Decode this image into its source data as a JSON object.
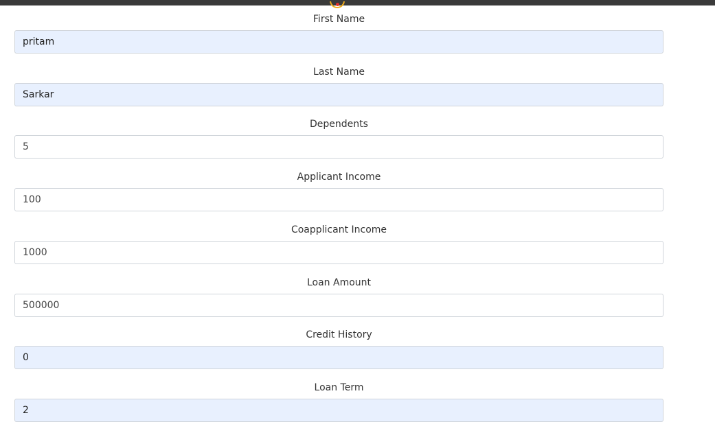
{
  "form": {
    "fields": [
      {
        "label": "First Name",
        "value": "pritam",
        "autofill": true
      },
      {
        "label": "Last Name",
        "value": "Sarkar",
        "autofill": true
      },
      {
        "label": "Dependents",
        "value": "5",
        "autofill": false
      },
      {
        "label": "Applicant Income",
        "value": "100",
        "autofill": false
      },
      {
        "label": "Coapplicant Income",
        "value": "1000",
        "autofill": false
      },
      {
        "label": "Loan Amount",
        "value": "500000",
        "autofill": false
      },
      {
        "label": "Credit History",
        "value": "0",
        "autofill": true
      },
      {
        "label": "Loan Term",
        "value": "2",
        "autofill": true
      }
    ]
  },
  "colors": {
    "top_bar": "#3a3a3a",
    "autofill_background": "#e8f0fe",
    "input_border": "#cfd4da",
    "logo_ring": "#f0ad1c",
    "logo_dot": "#e0312b"
  },
  "icons": {
    "logo": "logo-icon"
  }
}
